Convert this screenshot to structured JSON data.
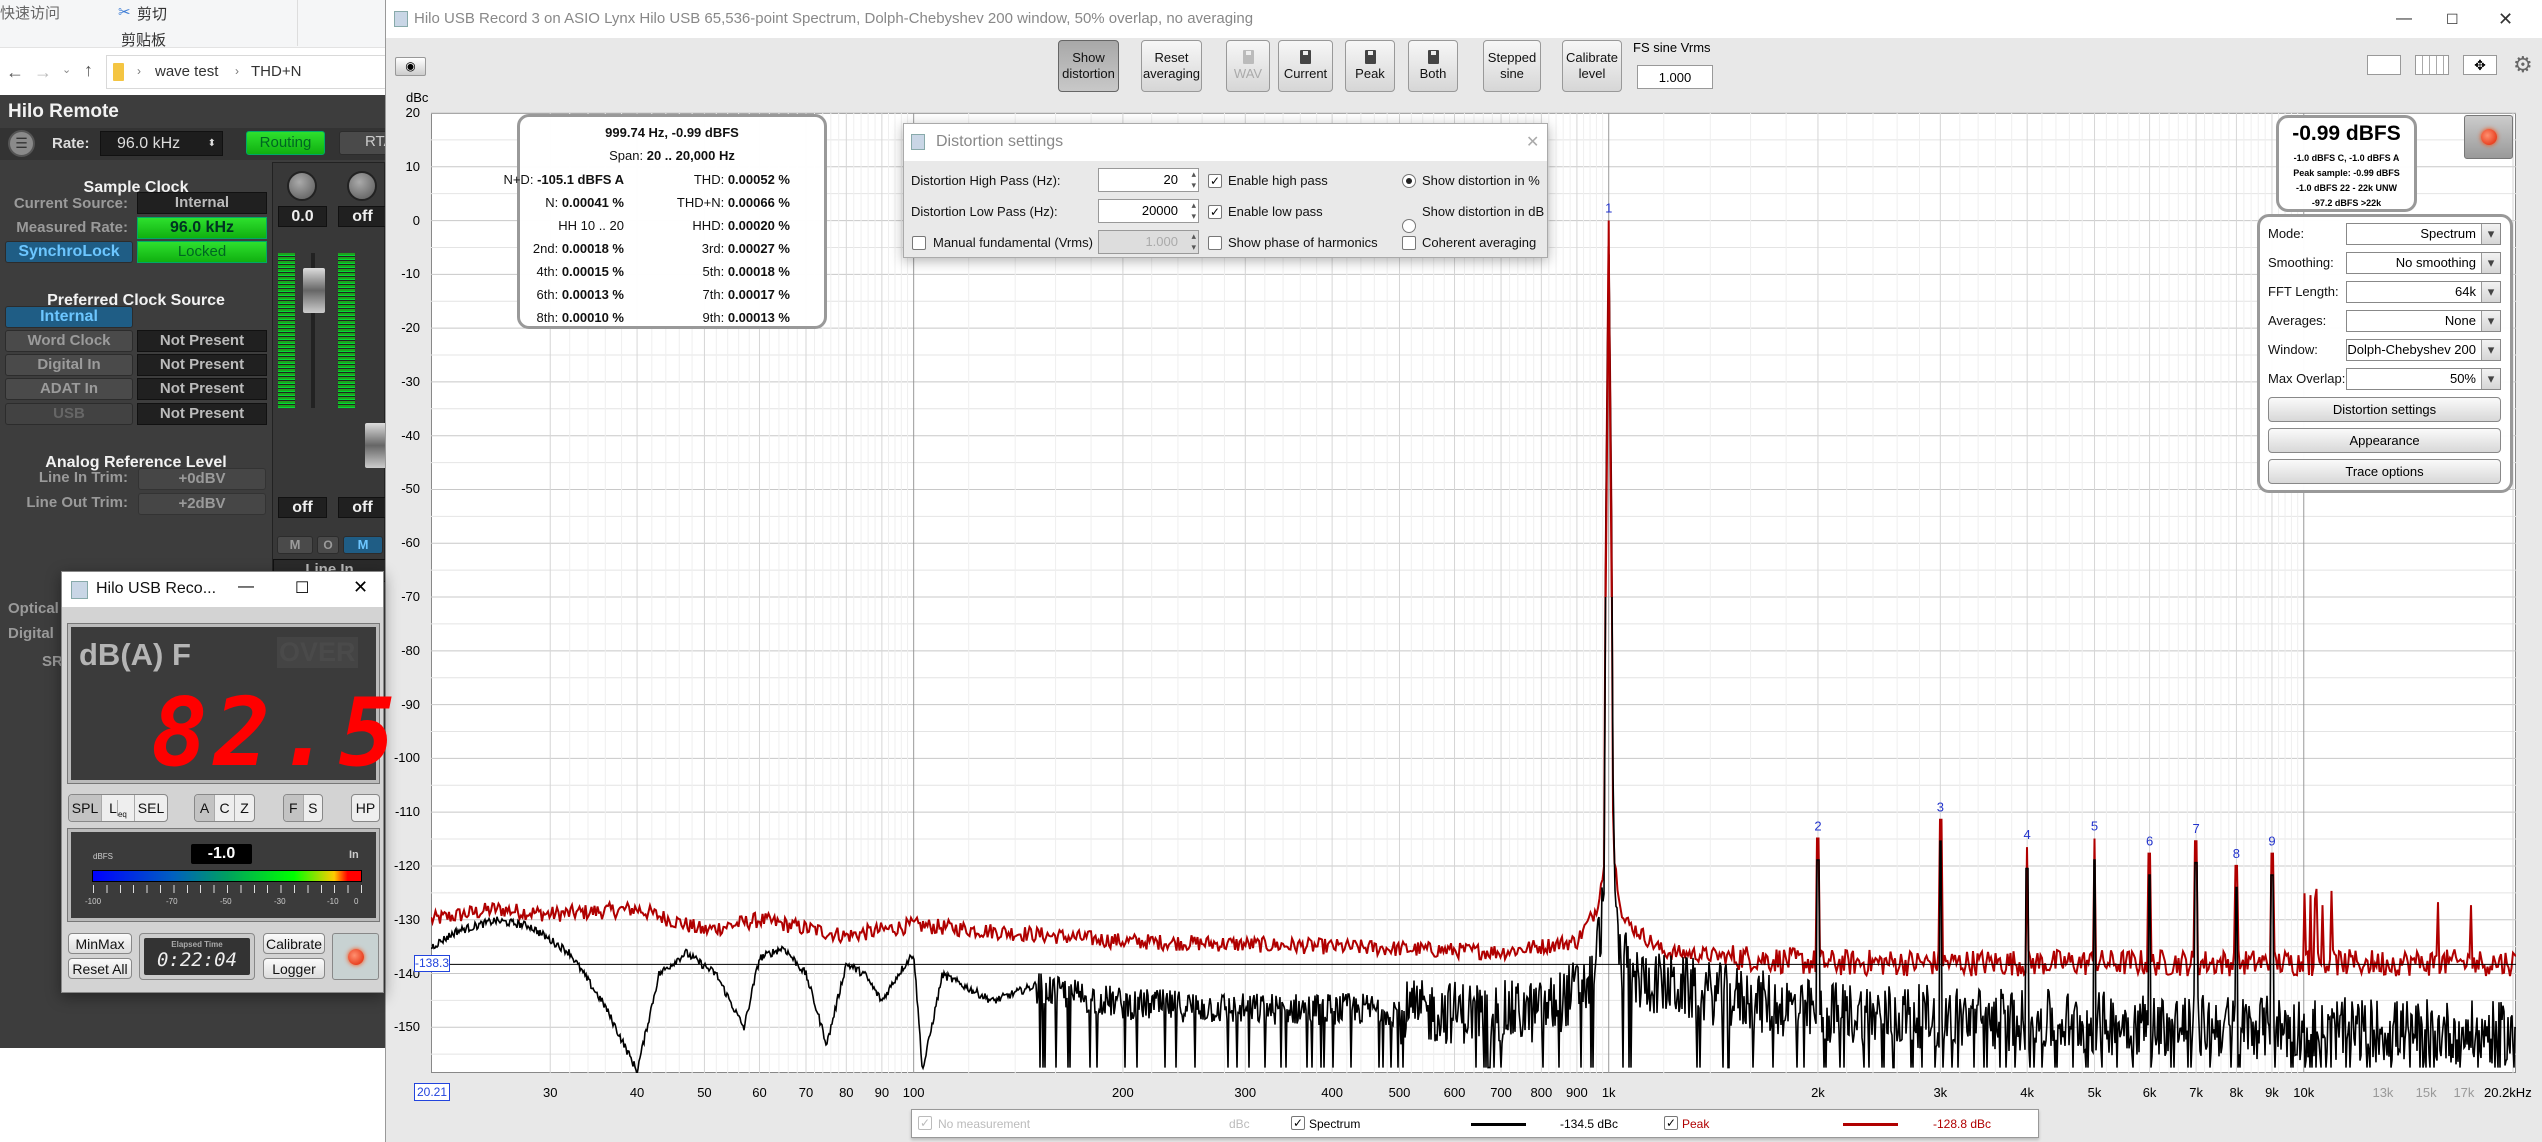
{
  "explorer": {
    "quick_access": "快速访问",
    "cut": "剪切",
    "clipboard": "剪贴板",
    "breadcrumb": [
      "wave test",
      "THD+N"
    ]
  },
  "hilo_remote": {
    "title": "Hilo Remote",
    "rate_label": "Rate:",
    "rate_value": "96.0 kHz",
    "routing_button": "Routing",
    "rta_button": "RTA",
    "sample_clock": {
      "heading": "Sample Clock",
      "current_source_label": "Current Source:",
      "current_source": "Internal",
      "measured_rate_label": "Measured Rate:",
      "measured_rate": "96.0 kHz",
      "synchrolock_button": "SynchroLock",
      "synchrolock_status": "Locked"
    },
    "preferred_clock": {
      "heading": "Preferred Clock Source",
      "sources": [
        {
          "label": "Internal",
          "status": ""
        },
        {
          "label": "Word Clock",
          "status": "Not Present"
        },
        {
          "label": "Digital In",
          "status": "Not Present"
        },
        {
          "label": "ADAT In",
          "status": "Not Present"
        },
        {
          "label": "USB",
          "status": "Not Present"
        }
      ]
    },
    "analog_ref": {
      "heading": "Analog Reference Level",
      "line_in_label": "Line In Trim:",
      "line_in_value": "+0dBV",
      "line_out_label": "Line Out Trim:",
      "line_out_value": "+2dBV"
    },
    "hidden_labels": [
      "Optical",
      "Digital",
      "SR"
    ],
    "mixer": {
      "pan_values": [
        "0.0",
        "off"
      ],
      "buttons": [
        "M",
        "O",
        "M"
      ],
      "input_label": "Line In",
      "bottom_values": [
        "off",
        "off"
      ]
    }
  },
  "rew": {
    "title": "Hilo USB Record 3 on ASIO Lynx Hilo USB 65,536-point Spectrum, Dolph-Chebyshev 200 window, 50% overlap, no averaging",
    "toolbar": {
      "show_distortion": [
        "Show",
        "distortion"
      ],
      "reset_averaging": [
        "Reset",
        "averaging"
      ],
      "wav": "WAV",
      "current": "Current",
      "peak": "Peak",
      "both": "Both",
      "stepped_sine": [
        "Stepped",
        "sine"
      ],
      "calibrate_level": [
        "Calibrate",
        "level"
      ],
      "fs_sine_label": "FS sine Vrms",
      "fs_sine_value": "1.000"
    },
    "y_unit": "dBc",
    "cursor_level": "-138.3",
    "x_start": "20.21",
    "stats": {
      "header1": "999.74 Hz, -0.99 dBFS",
      "span_label": "Span:",
      "span_value": "20 .. 20,000 Hz",
      "rows": [
        [
          {
            "k": "N+D:",
            "v": "-105.1 dBFS A"
          },
          {
            "k": "THD:",
            "v": "0.00052 %"
          }
        ],
        [
          {
            "k": "N:",
            "v": "0.00041 %"
          },
          {
            "k": "THD+N:",
            "v": "0.00066 %"
          }
        ],
        [
          {
            "k": "HH 10 .. 20",
            "v": ""
          },
          {
            "k": "HHD:",
            "v": "0.00020 %"
          }
        ],
        [
          {
            "k": "2nd:",
            "v": "0.00018 %"
          },
          {
            "k": "3rd:",
            "v": "0.00027 %"
          }
        ],
        [
          {
            "k": "4th:",
            "v": "0.00015 %"
          },
          {
            "k": "5th:",
            "v": "0.00018 %"
          }
        ],
        [
          {
            "k": "6th:",
            "v": "0.00013 %"
          },
          {
            "k": "7th:",
            "v": "0.00017 %"
          }
        ],
        [
          {
            "k": "8th:",
            "v": "0.00010 %"
          },
          {
            "k": "9th:",
            "v": "0.00013 %"
          }
        ]
      ]
    },
    "distortion_dialog": {
      "title": "Distortion settings",
      "high_pass_label": "Distortion High Pass (Hz):",
      "high_pass_value": "20",
      "low_pass_label": "Distortion Low Pass (Hz):",
      "low_pass_value": "20000",
      "manual_fundamental_label": "Manual fundamental (Vrms)",
      "manual_fundamental_value": "1.000",
      "enable_high_pass": "Enable high pass",
      "enable_low_pass": "Enable low pass",
      "show_phase": "Show phase of harmonics",
      "show_pct": "Show distortion in %",
      "show_db": "Show distortion in dB",
      "coherent": "Coherent averaging",
      "check_mark": "✓"
    },
    "level": {
      "main": "-0.99 dBFS",
      "lines": [
        "-1.0 dBFS C, -1.0 dBFS A",
        "Peak sample: -0.99 dBFS",
        "-1.0 dBFS 22 - 22k UNW",
        "-97.2 dBFS >22k"
      ]
    },
    "controls": {
      "rows": [
        {
          "label": "Mode:",
          "value": "Spectrum"
        },
        {
          "label": "Smoothing:",
          "value": "No  smoothing"
        },
        {
          "label": "FFT Length:",
          "value": "64k"
        },
        {
          "label": "Averages:",
          "value": "None"
        },
        {
          "label": "Window:",
          "value": "Dolph-Chebyshev 200"
        },
        {
          "label": "Max Overlap:",
          "value": "50%"
        }
      ],
      "buttons": [
        "Distortion settings",
        "Appearance",
        "Trace options"
      ]
    },
    "legend": {
      "no_measurement": "No measurement",
      "unit": "dBc",
      "spectrum": "Spectrum",
      "spectrum_value": "-134.5 dBc",
      "peak": "Peak",
      "peak_value": "-128.8 dBc"
    }
  },
  "meter_window": {
    "title": "Hilo USB Reco...",
    "weighting_display": "dB(A) F",
    "over": "OVER",
    "reading": "82.5",
    "seg1": [
      "SPL",
      "L",
      "SEL"
    ],
    "leq_sub": "eq",
    "seg2": [
      "A",
      "C",
      "Z"
    ],
    "seg3": [
      "F",
      "S"
    ],
    "hp": "HP",
    "dbfs_label": "dBFS",
    "dbfs_value": "-1.0",
    "in_label": "In",
    "scale": [
      "-100",
      "-70",
      "-50",
      "-30",
      "-10",
      "0"
    ],
    "minmax": "MinMax",
    "reset_all": "Reset All",
    "elapsed_label": "Elapsed Time",
    "elapsed": "0:22:04",
    "calibrate": "Calibrate",
    "logger": "Logger"
  },
  "chart_data": {
    "type": "line",
    "xscale": "log",
    "xlim": [
      20.21,
      20200
    ],
    "ylim": [
      -158.5,
      20
    ],
    "ylabel": "dBc",
    "grid": true,
    "x_ticks": [
      {
        "f": 30,
        "t": "30"
      },
      {
        "f": 40,
        "t": "40"
      },
      {
        "f": 50,
        "t": "50"
      },
      {
        "f": 60,
        "t": "60"
      },
      {
        "f": 70,
        "t": "70"
      },
      {
        "f": 80,
        "t": "80"
      },
      {
        "f": 90,
        "t": "90"
      },
      {
        "f": 100,
        "t": "100"
      },
      {
        "f": 200,
        "t": "200"
      },
      {
        "f": 300,
        "t": "300"
      },
      {
        "f": 400,
        "t": "400"
      },
      {
        "f": 500,
        "t": "500"
      },
      {
        "f": 600,
        "t": "600"
      },
      {
        "f": 700,
        "t": "700"
      },
      {
        "f": 800,
        "t": "800"
      },
      {
        "f": 900,
        "t": "900"
      },
      {
        "f": 1000,
        "t": "1k"
      },
      {
        "f": 2000,
        "t": "2k"
      },
      {
        "f": 3000,
        "t": "3k"
      },
      {
        "f": 4000,
        "t": "4k"
      },
      {
        "f": 5000,
        "t": "5k"
      },
      {
        "f": 6000,
        "t": "6k"
      },
      {
        "f": 7000,
        "t": "7k"
      },
      {
        "f": 8000,
        "t": "8k"
      },
      {
        "f": 9000,
        "t": "9k"
      },
      {
        "f": 10000,
        "t": "10k"
      },
      {
        "f": 13000,
        "t": "13k",
        "grey": true
      },
      {
        "f": 15000,
        "t": "15k",
        "grey": true
      },
      {
        "f": 17000,
        "t": "17k",
        "grey": true
      },
      {
        "f": 20200,
        "t": "20.2kHz"
      }
    ],
    "y_ticks": [
      20,
      10,
      0,
      -10,
      -20,
      -30,
      -40,
      -50,
      -60,
      -70,
      -80,
      -90,
      -100,
      -110,
      -120,
      -130,
      -140,
      -150
    ],
    "fundamental": {
      "label": "1",
      "f": 1000,
      "dbc": 0
    },
    "harmonics": [
      {
        "label": "2",
        "f": 2000,
        "dbc": -114.9
      },
      {
        "label": "3",
        "f": 3000,
        "dbc": -111.4
      },
      {
        "label": "4",
        "f": 4000,
        "dbc": -116.5
      },
      {
        "label": "5",
        "f": 5000,
        "dbc": -114.9
      },
      {
        "label": "6",
        "f": 6000,
        "dbc": -117.7
      },
      {
        "label": "7",
        "f": 7000,
        "dbc": -115.4
      },
      {
        "label": "8",
        "f": 8000,
        "dbc": -120.0
      },
      {
        "label": "9",
        "f": 9000,
        "dbc": -117.7
      }
    ],
    "cursor_line_dbc": -138.3,
    "series": [
      {
        "name": "Spectrum",
        "color": "#000000",
        "points": [
          [
            20.2,
            -135
          ],
          [
            22,
            -132
          ],
          [
            25,
            -130
          ],
          [
            28,
            -131
          ],
          [
            32,
            -136
          ],
          [
            36,
            -146
          ],
          [
            40,
            -158
          ],
          [
            43,
            -140
          ],
          [
            47,
            -136
          ],
          [
            52,
            -140
          ],
          [
            57,
            -150
          ],
          [
            60,
            -137
          ],
          [
            65,
            -135
          ],
          [
            70,
            -140
          ],
          [
            75,
            -153
          ],
          [
            80,
            -138
          ],
          [
            85,
            -140
          ],
          [
            90,
            -145
          ],
          [
            95,
            -140
          ],
          [
            100,
            -136
          ],
          [
            103,
            -158
          ],
          [
            110,
            -140
          ],
          [
            130,
            -145
          ],
          [
            150,
            -142
          ],
          [
            200,
            -145
          ],
          [
            300,
            -146
          ],
          [
            500,
            -146
          ],
          [
            800,
            -146
          ],
          [
            950,
            -140
          ],
          [
            985,
            -125
          ],
          [
            990,
            -60
          ],
          [
            997,
            -20
          ],
          [
            1000,
            0
          ],
          [
            1003,
            -20
          ],
          [
            1010,
            -60
          ],
          [
            1015,
            -110
          ],
          [
            1030,
            -135
          ],
          [
            1100,
            -140
          ],
          [
            2000,
            -146
          ],
          [
            5000,
            -148
          ],
          [
            20000,
            -150
          ]
        ]
      },
      {
        "name": "Peak",
        "color": "#b00000",
        "points": [
          [
            20.2,
            -130
          ],
          [
            25,
            -128
          ],
          [
            30,
            -129
          ],
          [
            40,
            -128
          ],
          [
            50,
            -132
          ],
          [
            60,
            -130
          ],
          [
            80,
            -133
          ],
          [
            100,
            -131
          ],
          [
            200,
            -134
          ],
          [
            400,
            -135
          ],
          [
            700,
            -136
          ],
          [
            900,
            -134
          ],
          [
            960,
            -128
          ],
          [
            985,
            -120
          ],
          [
            990,
            -60
          ],
          [
            997,
            -20
          ],
          [
            1000,
            0
          ],
          [
            1003,
            -20
          ],
          [
            1010,
            -60
          ],
          [
            1015,
            -118
          ],
          [
            1050,
            -130
          ],
          [
            1200,
            -136
          ],
          [
            2000,
            -138
          ],
          [
            20000,
            -138
          ]
        ]
      }
    ]
  }
}
